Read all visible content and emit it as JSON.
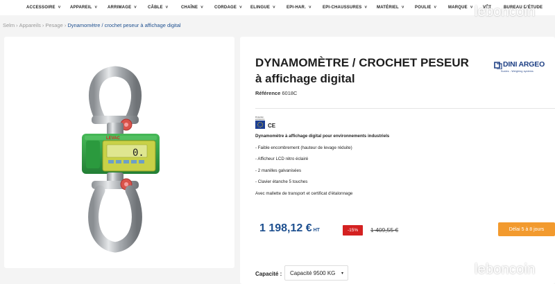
{
  "nav": {
    "items": [
      {
        "label": "ACCESSOIRE",
        "width": 63
      },
      {
        "label": "APPAREIL",
        "width": 54
      },
      {
        "label": "ARRIMAGE",
        "width": 58
      },
      {
        "label": "CÂBLE",
        "width": 48
      },
      {
        "label": "CHAÎNE",
        "width": 48
      },
      {
        "label": "CORDAGE",
        "width": 52
      },
      {
        "label": "ELINGUE",
        "width": 52
      },
      {
        "label": "EPI-HAR.",
        "width": 52
      },
      {
        "label": "EPI-CHAUSSURES",
        "width": 78
      },
      {
        "label": "MATÉRIEL",
        "width": 55
      },
      {
        "label": "POULIE",
        "width": 48
      },
      {
        "label": "MARQUE",
        "width": 50
      },
      {
        "label": "VÊT",
        "width": 30
      },
      {
        "label": "BUREAU D'ÉTUDE",
        "width": 70
      }
    ]
  },
  "breadcrumb": {
    "items": [
      "Selm",
      "Appareils",
      "Pesage"
    ],
    "current": "Dynamomètre / crochet peseur à affichage digital"
  },
  "product": {
    "title_line1": "DYNAMOMÈTRE / CROCHET PESEUR",
    "title_line2": "à affichage digital",
    "reference_label": "Référence",
    "reference_value": "6018C",
    "ce_label": "CE",
    "origin_badge": "Production européenne",
    "description_lead": "Dynamomètre à affichage digital pour environnements industriels",
    "features": [
      "- Faible encombrement (hauteur de levage réduite)",
      "- Afficheur LCD rétro éclairé",
      "- 2 manilles galvanisées",
      "- Clavier étanche 5 touches"
    ],
    "description_footer": "Avec mallette de transport et certificat d'étalonnage",
    "price": "1 198,12 €",
    "price_suffix": "HT",
    "discount": "-15%",
    "old_price": "1 409,55 €",
    "delivery": "Délai 5 à 8 jours",
    "capacity_label": "Capacité :",
    "capacity_value": "Capacité 9500 KG"
  },
  "device": {
    "brand": "LEVAC",
    "display": "0."
  },
  "brand_logo": {
    "name": "DINI ARGEO",
    "tagline": "Scales - Weighing systems"
  },
  "watermark": "leboncoin",
  "colors": {
    "accent_blue": "#1d4f8f",
    "discount_red": "#d42121",
    "delivery_orange": "#f29a2e",
    "device_green": "#2da043",
    "display_yellow": "#d8e06a",
    "brand_navy": "#1d3f84"
  }
}
